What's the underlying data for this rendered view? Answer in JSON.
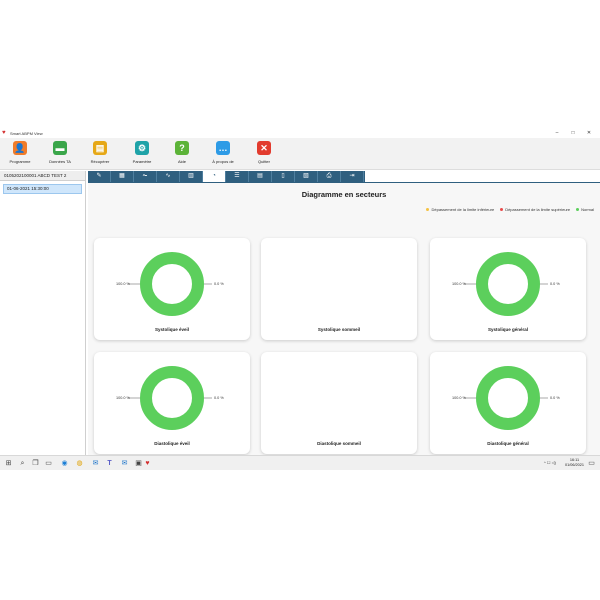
{
  "window": {
    "title": "Smart ABPM View",
    "app_icon": "heart-icon",
    "controls": [
      "–",
      "□",
      "✕"
    ]
  },
  "toolbar": {
    "items": [
      {
        "label": "Programme",
        "icon": "user-program-icon",
        "color": "#f07c2a",
        "glyph": "👤"
      },
      {
        "label": "Données TA",
        "icon": "folder-icon",
        "color": "#3aa64a",
        "glyph": "▬"
      },
      {
        "label": "Récupérer",
        "icon": "clipboard-icon",
        "color": "#e6a817",
        "glyph": "▤"
      },
      {
        "label": "Paramètre",
        "icon": "gear-icon",
        "color": "#1fa3a8",
        "glyph": "⚙"
      },
      {
        "label": "Aide",
        "icon": "help-icon",
        "color": "#5cb338",
        "glyph": "?"
      },
      {
        "label": "À propos de",
        "icon": "chat-icon",
        "color": "#2d9be6",
        "glyph": "…"
      },
      {
        "label": "Quitter",
        "icon": "close-icon",
        "color": "#e23b2e",
        "glyph": "✕"
      }
    ]
  },
  "left_panel": {
    "patient": "0105202100001 ABCD TEST 2",
    "records": [
      "01-06-2021 15:30:00"
    ]
  },
  "tabs": {
    "active_index": 5,
    "icons": [
      "edit-icon",
      "table-icon",
      "line-chart-icon",
      "trend-icon",
      "bar-chart-icon",
      "pie-chart-icon",
      "list-chart-icon",
      "stats-icon",
      "document-icon",
      "pdf-icon",
      "print-icon",
      "export-icon"
    ],
    "glyphs": [
      "✎",
      "▦",
      "⏦",
      "∿",
      "▥",
      "◔",
      "☰",
      "▤",
      "▯",
      "▧",
      "⎙",
      "⇥"
    ]
  },
  "chart_data": {
    "type": "pie",
    "title": "Diagramme en secteurs",
    "legend": [
      {
        "name": "Dépassement de la limite inférieure",
        "color": "#f5c242"
      },
      {
        "name": "Dépassement de la limite supérieure",
        "color": "#e84a4a"
      },
      {
        "name": "Normal",
        "color": "#5ccf5c"
      }
    ],
    "legend_placement": "top-right",
    "charts": [
      {
        "label": "Systolique éveil",
        "has_data": true,
        "normal": 100.0,
        "other": 0.0,
        "left_text": "100.0 %",
        "right_text": "0.0 %"
      },
      {
        "label": "Systolique sommeil",
        "has_data": false
      },
      {
        "label": "Systolique général",
        "has_data": true,
        "normal": 100.0,
        "other": 0.0,
        "left_text": "100.0 %",
        "right_text": "0.0 %"
      },
      {
        "label": "Diastolique éveil",
        "has_data": true,
        "normal": 100.0,
        "other": 0.0,
        "left_text": "100.0 %",
        "right_text": "0.0 %"
      },
      {
        "label": "Diastolique sommeil",
        "has_data": false
      },
      {
        "label": "Diastolique général",
        "has_data": true,
        "normal": 100.0,
        "other": 0.0,
        "left_text": "100.0 %",
        "right_text": "0.0 %"
      }
    ]
  },
  "taskbar": {
    "icons": [
      {
        "name": "windows-start-icon",
        "glyph": "⊞"
      },
      {
        "name": "search-icon",
        "glyph": "⌕"
      },
      {
        "name": "task-view-icon",
        "glyph": "❐"
      },
      {
        "name": "file-explorer-icon",
        "glyph": "▭"
      },
      {
        "name": "edge-browser-icon",
        "glyph": "◉"
      },
      {
        "name": "chrome-browser-icon",
        "glyph": "◍"
      },
      {
        "name": "outlook-icon",
        "glyph": "✉"
      },
      {
        "name": "teams-icon",
        "glyph": "T"
      },
      {
        "name": "mail-icon",
        "glyph": "✉"
      },
      {
        "name": "app-icon",
        "glyph": "▣"
      },
      {
        "name": "smart-abpm-icon",
        "glyph": "♥"
      }
    ],
    "tray": "^ ☐ ◁)",
    "time": "16:11",
    "date": "01/06/2021"
  }
}
